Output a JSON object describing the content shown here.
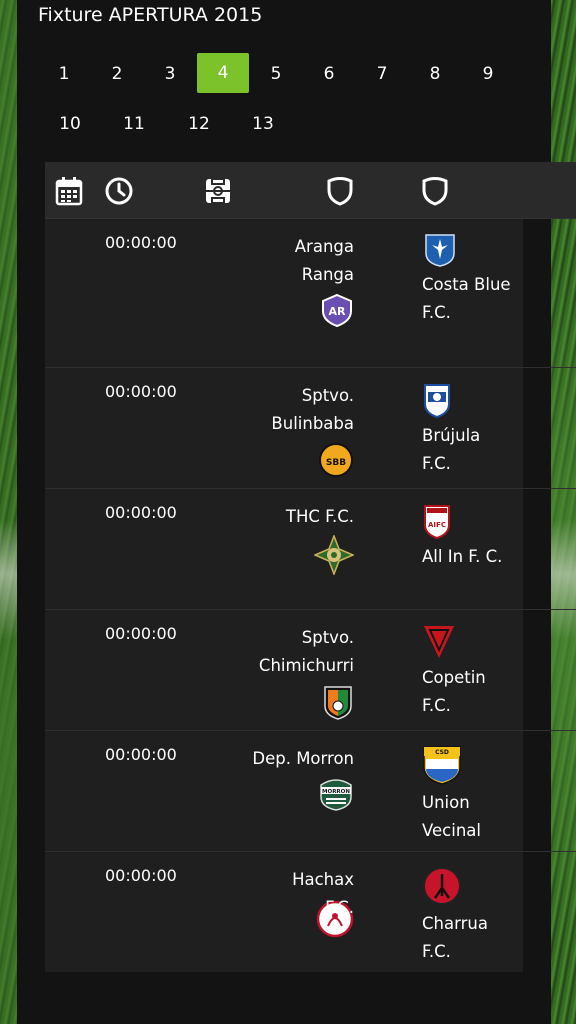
{
  "title": "Fixture APERTURA 2015",
  "rounds": [
    "1",
    "2",
    "3",
    "4",
    "5",
    "6",
    "7",
    "8",
    "9",
    "10",
    "11",
    "12",
    "13"
  ],
  "active_round": "4",
  "columns": [
    "calendar-icon",
    "clock-icon",
    "field-icon",
    "home-shield-icon",
    "away-shield-icon"
  ],
  "colors": {
    "accent": "#7cc22a",
    "panel": "#131313",
    "row": "#1f1f1f",
    "header": "#2a2a2a"
  },
  "matches": [
    {
      "time": "00:00:00",
      "home": {
        "name": "Aranga Ranga",
        "logo_text": "AR"
      },
      "away": {
        "name": "Costa Blue F.C."
      }
    },
    {
      "time": "00:00:00",
      "home": {
        "name": "Sptvo. Bulinbaba",
        "logo_text": "SBB"
      },
      "away": {
        "name": "Brújula F.C."
      }
    },
    {
      "time": "00:00:00",
      "home": {
        "name": "THC F.C."
      },
      "away": {
        "name": "All In F. C.",
        "logo_text": "AIFC"
      }
    },
    {
      "time": "00:00:00",
      "home": {
        "name": "Sptvo. Chimichurri"
      },
      "away": {
        "name": "Copetin F.C."
      }
    },
    {
      "time": "00:00:00",
      "home": {
        "name": "Dep. Morron",
        "logo_text": "MORRON"
      },
      "away": {
        "name": "Union Vecinal",
        "logo_text": "CSD"
      }
    },
    {
      "time": "00:00:00",
      "home": {
        "name": "Hachax F.C."
      },
      "away": {
        "name": "Charrua F.C."
      }
    }
  ]
}
